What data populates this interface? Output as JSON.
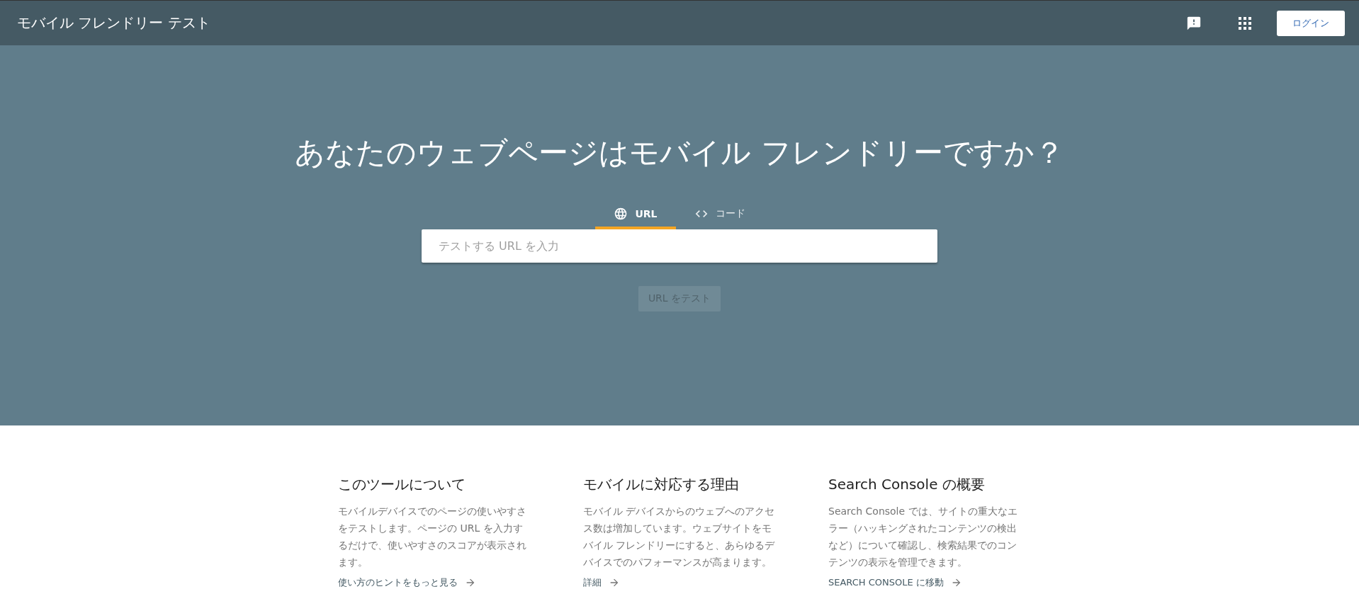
{
  "header": {
    "title": "モバイル フレンドリー テスト",
    "login": "ログイン"
  },
  "hero": {
    "title": "あなたのウェブページはモバイル フレンドリーですか？",
    "tabs": [
      {
        "kind": "globe",
        "label": "URL",
        "selected": true
      },
      {
        "kind": "code",
        "label": "コード",
        "selected": false
      }
    ],
    "input": {
      "placeholder": "テストする URL を入力"
    },
    "button": {
      "label": "URL をテスト",
      "disabled": true
    }
  },
  "columns": [
    {
      "title": "このツールについて",
      "body": "モバイルデバイスでのページの使いやすさをテストします。ページの URL を入力するだけで、使いやすさのスコアが表示されます。",
      "link": "使い方のヒントをもっと見る"
    },
    {
      "title": "モバイルに対応する理由",
      "body": "モバイル デバイスからのウェブへのアクセス数は増加しています。ウェブサイトをモバイル フレンドリーにすると、あらゆるデバイスでのパフォーマンスが高まります。",
      "link": "詳細"
    },
    {
      "title": "Search Console の概要",
      "body": "Search Console では、サイトの重大なエラー（ハッキングされたコンテンツの検出など）について確認し、検索結果でのコンテンツの表示を管理できます。",
      "link": "SEARCH CONSOLE に移動"
    }
  ]
}
